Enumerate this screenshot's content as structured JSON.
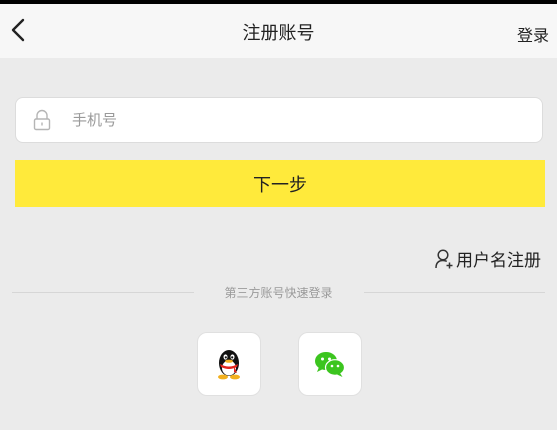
{
  "header": {
    "title": "注册账号",
    "login_label": "登录"
  },
  "form": {
    "phone_placeholder": "手机号",
    "phone_value": "",
    "next_label": "下一步"
  },
  "alt_register": {
    "label": "用户名注册",
    "icon": "user-add-icon"
  },
  "third_party": {
    "divider_text": "第三方账号快速登录",
    "providers": [
      {
        "icon": "qq-icon"
      },
      {
        "icon": "wechat-icon"
      }
    ]
  },
  "colors": {
    "accent": "#ffea3b",
    "background": "#ebebeb",
    "wechat_green": "#3cc51f"
  }
}
